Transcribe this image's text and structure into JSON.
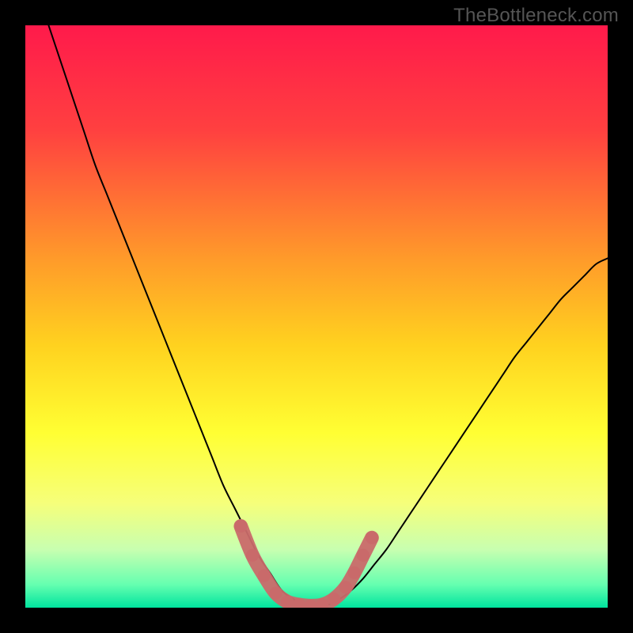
{
  "watermark": "TheBottleneck.com",
  "chart_data": {
    "type": "line",
    "title": "",
    "xlabel": "",
    "ylabel": "",
    "xlim": [
      0,
      100
    ],
    "ylim": [
      0,
      100
    ],
    "grid": false,
    "background_gradient": {
      "stops": [
        {
          "offset": 0.0,
          "color": "#ff1a4b"
        },
        {
          "offset": 0.18,
          "color": "#ff4040"
        },
        {
          "offset": 0.4,
          "color": "#ff9a2a"
        },
        {
          "offset": 0.55,
          "color": "#ffd21f"
        },
        {
          "offset": 0.7,
          "color": "#ffff33"
        },
        {
          "offset": 0.82,
          "color": "#f6ff7a"
        },
        {
          "offset": 0.9,
          "color": "#c8ffb0"
        },
        {
          "offset": 0.96,
          "color": "#66ffb0"
        },
        {
          "offset": 1.0,
          "color": "#00e49e"
        }
      ]
    },
    "series": [
      {
        "name": "curve",
        "x": [
          4,
          6,
          8,
          10,
          12,
          14,
          16,
          18,
          20,
          22,
          24,
          26,
          28,
          30,
          32,
          34,
          36,
          38,
          40,
          42,
          44,
          46,
          48,
          50,
          52,
          54,
          56,
          58,
          60,
          62,
          64,
          66,
          68,
          70,
          72,
          74,
          76,
          78,
          80,
          82,
          84,
          86,
          88,
          90,
          92,
          94,
          96,
          98,
          100
        ],
        "y": [
          100,
          94,
          88,
          82,
          76,
          71,
          66,
          61,
          56,
          51,
          46,
          41,
          36,
          31,
          26,
          21,
          17,
          13,
          9,
          6,
          3,
          1.5,
          0.6,
          0.2,
          0.5,
          1.5,
          3,
          5,
          7.5,
          10,
          13,
          16,
          19,
          22,
          25,
          28,
          31,
          34,
          37,
          40,
          43,
          45.5,
          48,
          50.5,
          53,
          55,
          57,
          59,
          60
        ]
      }
    ],
    "markers": {
      "color": "#c96a6a",
      "radius_pct": 1.1,
      "points": [
        {
          "x": 37,
          "y": 14
        },
        {
          "x": 39,
          "y": 9
        },
        {
          "x": 41,
          "y": 5.5
        },
        {
          "x": 43,
          "y": 2.5
        },
        {
          "x": 45,
          "y": 1
        },
        {
          "x": 47,
          "y": 0.5
        },
        {
          "x": 49,
          "y": 0.3
        },
        {
          "x": 51,
          "y": 0.5
        },
        {
          "x": 53,
          "y": 1.5
        },
        {
          "x": 55,
          "y": 3.5
        },
        {
          "x": 56.5,
          "y": 6
        },
        {
          "x": 58,
          "y": 9
        },
        {
          "x": 59.5,
          "y": 12
        }
      ]
    }
  }
}
